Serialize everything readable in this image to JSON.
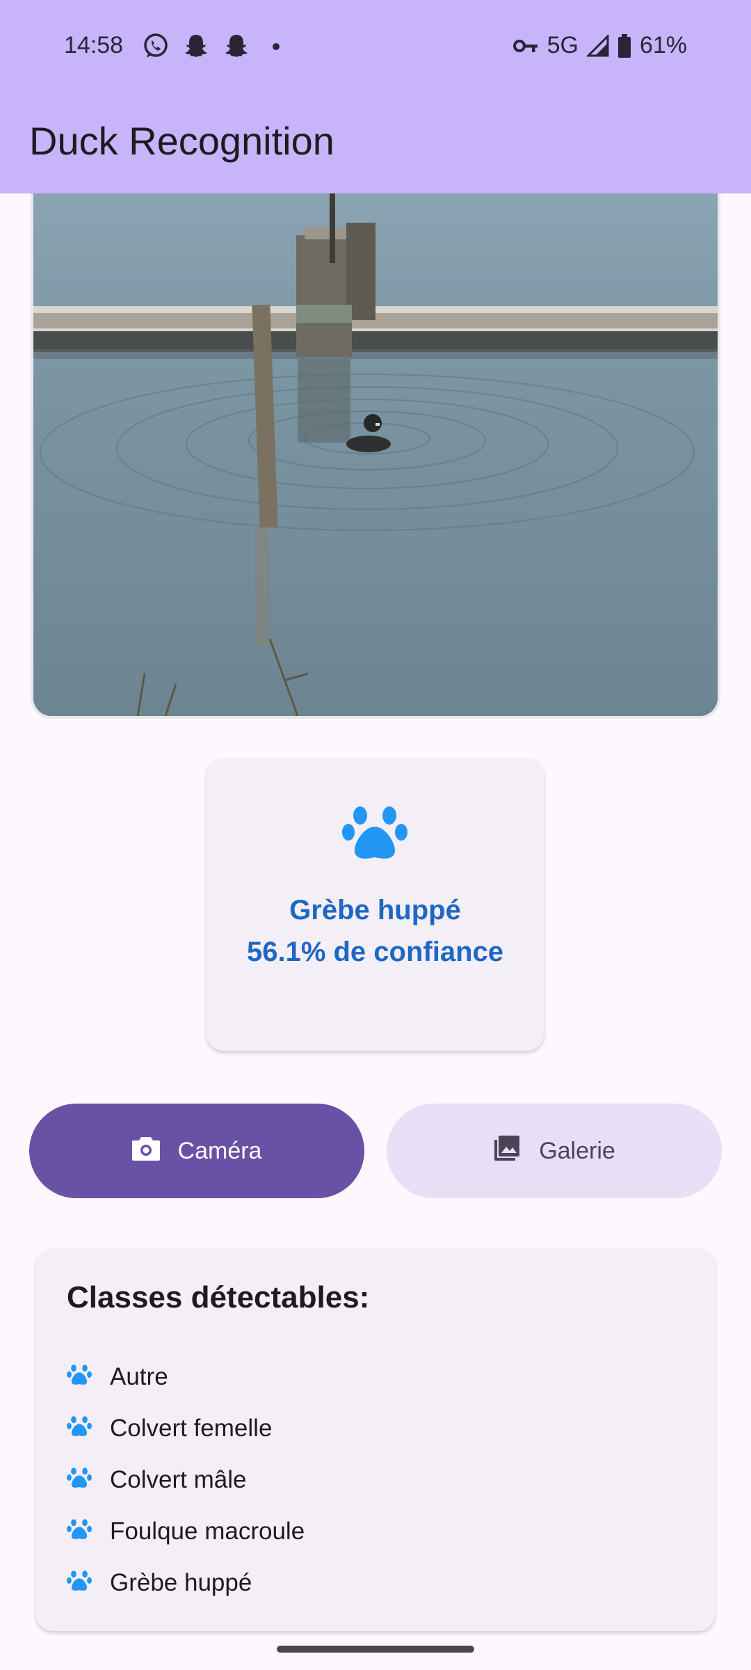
{
  "status_bar": {
    "time": "14:58",
    "network": "5G",
    "battery": "61%",
    "notification_icons": [
      "whatsapp-icon",
      "snapchat-icon",
      "snapchat-icon",
      "more-dot-icon"
    ],
    "system_icons": [
      "vpn-key-icon",
      "signal-icon",
      "battery-icon"
    ]
  },
  "app_bar": {
    "title": "Duck Recognition",
    "color": "#c7b4f9"
  },
  "result": {
    "icon": "paw-icon",
    "label": "Grèbe huppé",
    "confidence_text": "56.1% de confiance",
    "confidence": 0.561,
    "color": "#1e67c4"
  },
  "buttons": {
    "camera": {
      "label": "Caméra",
      "icon": "camera-icon",
      "color": "#6951a5"
    },
    "gallery": {
      "label": "Galerie",
      "icon": "image-icon",
      "color": "#e8def5"
    }
  },
  "classes": {
    "heading": "Classes détectables:",
    "items": [
      {
        "label": "Autre",
        "icon": "paw-icon"
      },
      {
        "label": "Colvert femelle",
        "icon": "paw-icon"
      },
      {
        "label": "Colvert mâle",
        "icon": "paw-icon"
      },
      {
        "label": "Foulque macroule",
        "icon": "paw-icon"
      },
      {
        "label": "Grèbe huppé",
        "icon": "paw-icon"
      }
    ]
  },
  "accent_color": "#2196f3"
}
